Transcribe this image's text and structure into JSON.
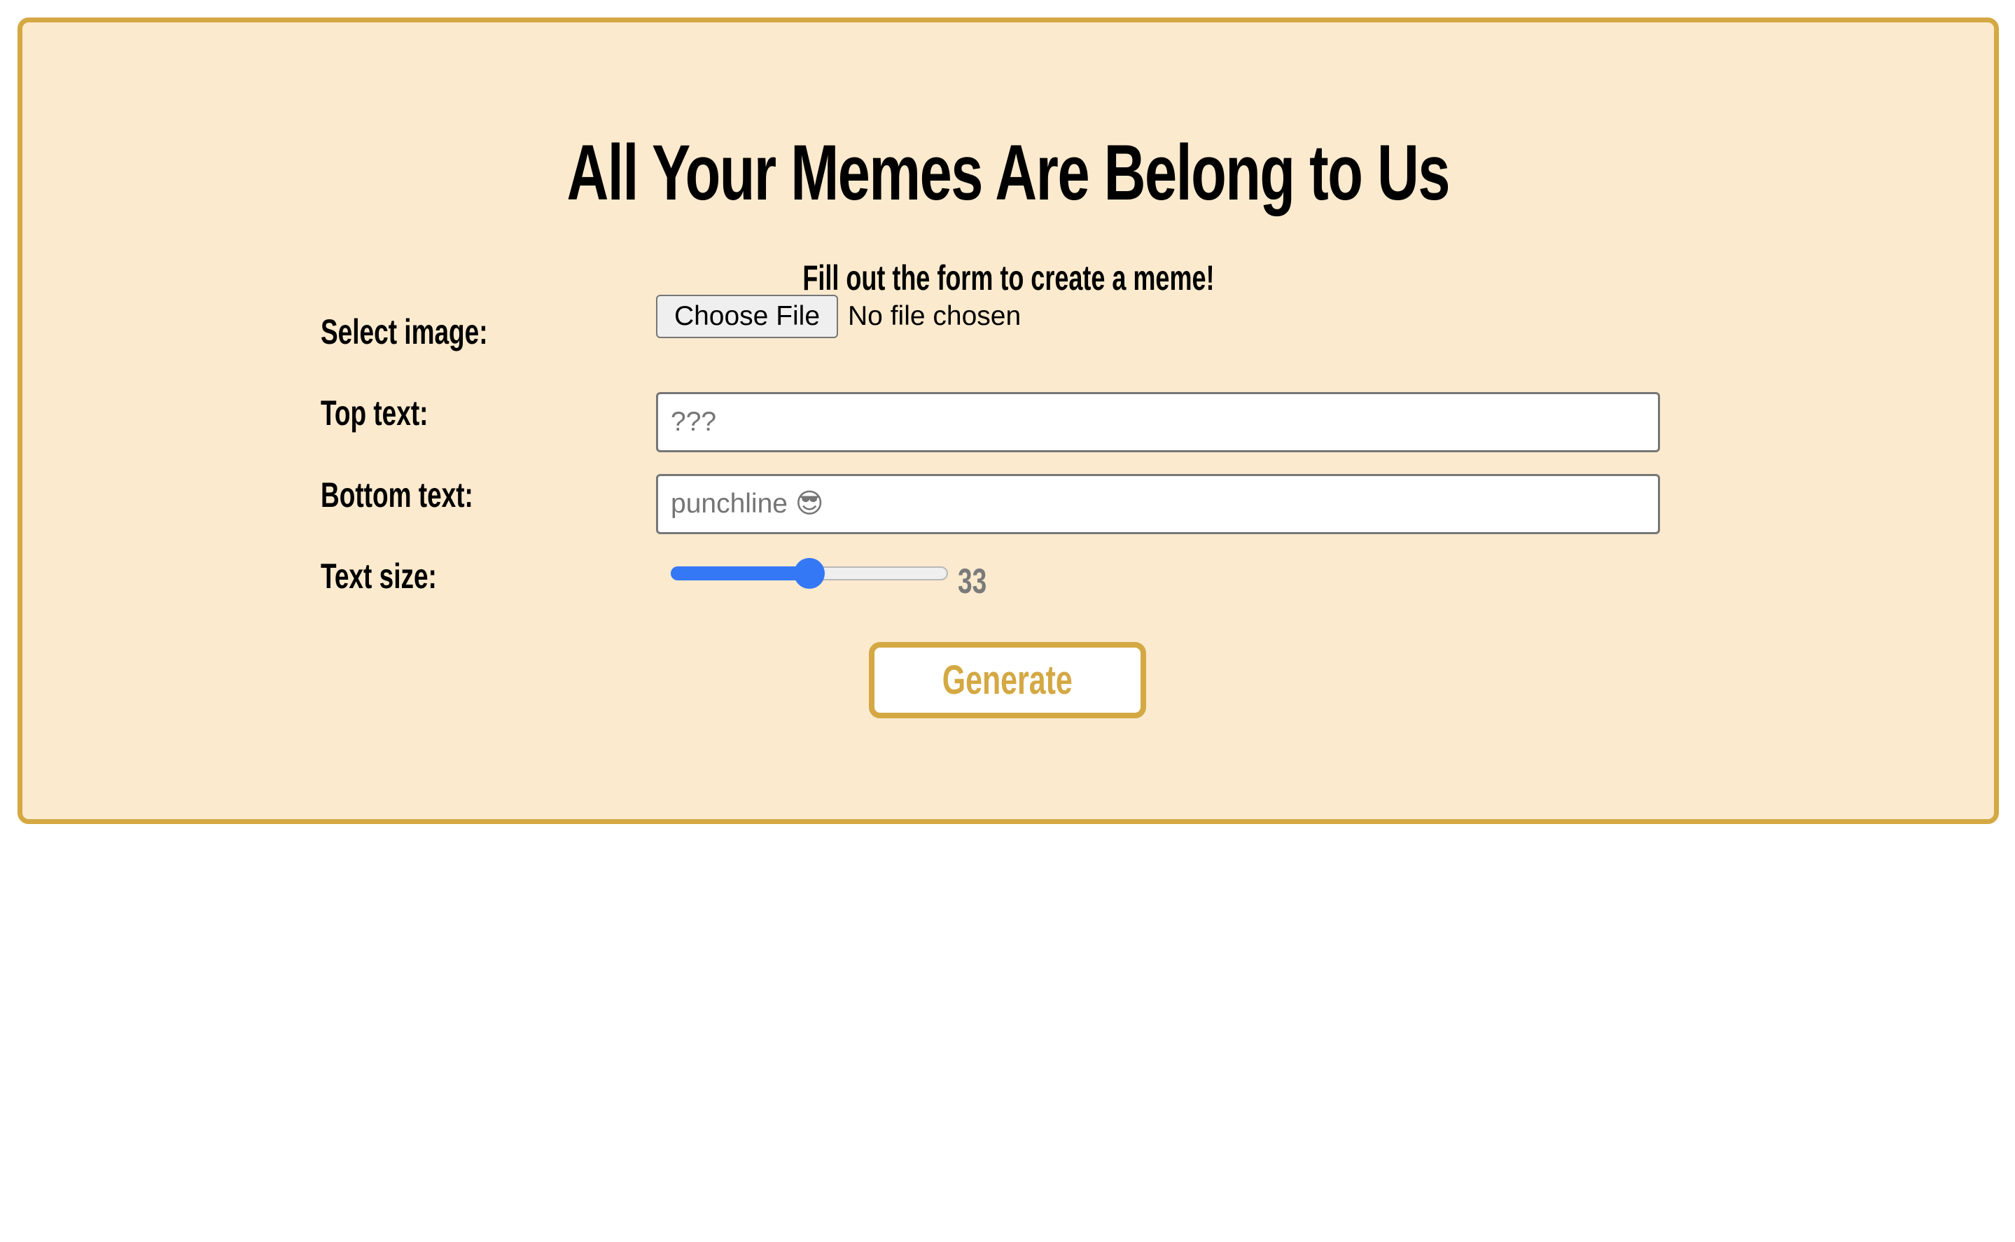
{
  "page": {
    "title": "All Your Memes Are Belong to Us",
    "subtitle": "Fill out the form to create a meme!"
  },
  "form": {
    "image": {
      "label": "Select image:",
      "button_label": "Choose File",
      "status": "No file chosen"
    },
    "top_text": {
      "label": "Top text:",
      "value": "",
      "placeholder": "???"
    },
    "bottom_text": {
      "label": "Bottom text:",
      "value": "",
      "placeholder": "punchline 😎"
    },
    "text_size": {
      "label": "Text size:",
      "value": "33",
      "slider_fraction": 0.5
    },
    "generate_label": "Generate"
  },
  "colors": {
    "panel_background": "#fbeace",
    "accent": "#d4a843",
    "slider": "#3478f6",
    "size_value": "#7a7a7a"
  }
}
